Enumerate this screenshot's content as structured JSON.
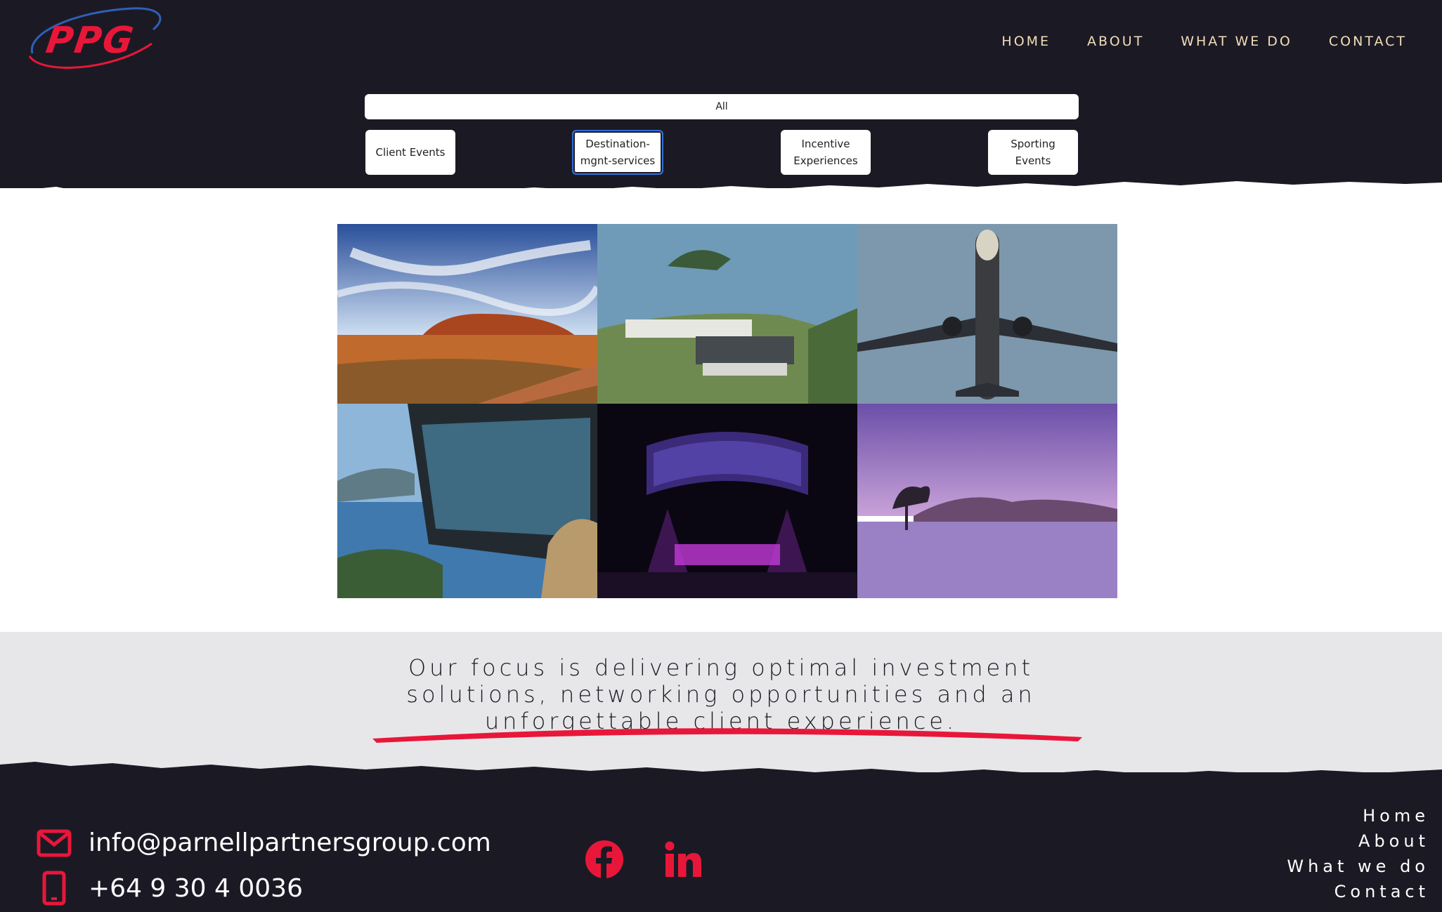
{
  "brand": {
    "logo_text": "PPG"
  },
  "nav": {
    "items": [
      "HOME",
      "ABOUT",
      "WHAT WE DO",
      "CONTACT"
    ]
  },
  "filters": {
    "all_label": "All",
    "buttons": [
      "Client Events",
      "Destination-mgnt-services",
      "Incentive Experiences",
      "Sporting Events"
    ],
    "active": "Destination-mgnt-services"
  },
  "gallery": {
    "images": [
      "uluru-outback-photo",
      "island-resort-photo",
      "airplane-overhead-photo",
      "glass-building-lake-photo",
      "concert-stage-photo",
      "wanaka-tree-lake-photo"
    ]
  },
  "focus": {
    "statement": "Our focus is delivering optimal investment solutions, networking opportunities and an unforgettable client experience."
  },
  "footer": {
    "email": "info@parnellpartnersgroup.com",
    "phone": "+64 9 30 4 0036",
    "social": [
      "facebook-icon",
      "linkedin-icon"
    ],
    "nav": [
      "Home",
      "About",
      "What we do",
      "Contact"
    ]
  },
  "colors": {
    "brand_red": "#e8173a",
    "dark_bg": "#1b1a24",
    "nav_text": "#f2ddb8",
    "focus_bg": "#e7e7e9",
    "active_outline": "#2f6fd8"
  }
}
